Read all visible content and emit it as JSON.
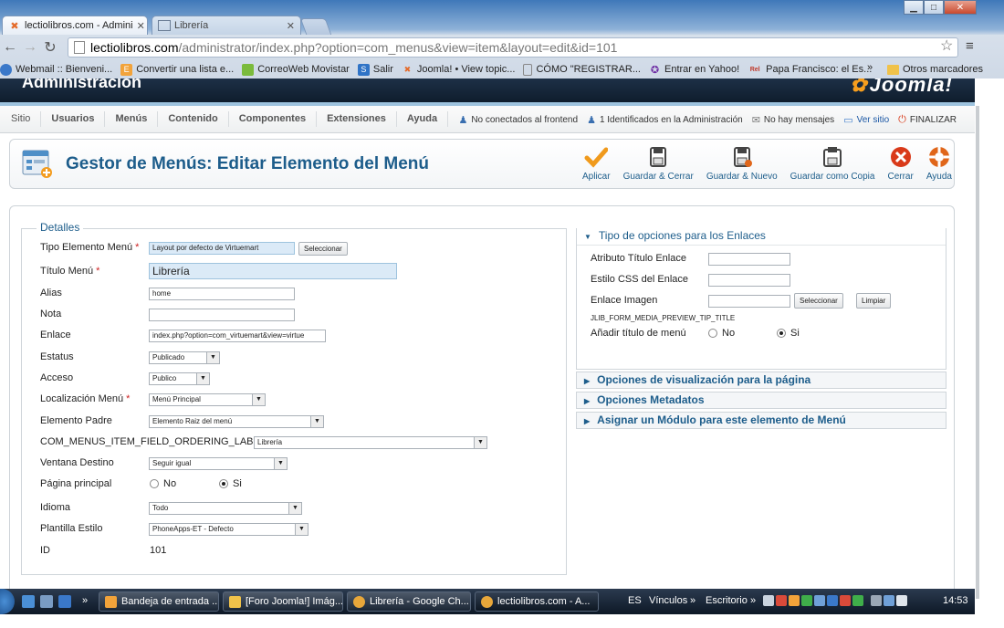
{
  "browser": {
    "tabs": [
      {
        "label": "lectiolibros.com - Admini",
        "active": true
      },
      {
        "label": "Librería",
        "active": false
      }
    ],
    "url_host": "lectiolibros.com",
    "url_path": "/administrator/index.php?option=com_menus&view=item&layout=edit&id=101",
    "bookmarks": [
      {
        "label": "Webmail :: Bienveni...",
        "color": "#3a78c9"
      },
      {
        "label": "Convertir una lista e...",
        "color": "#f2a33a"
      },
      {
        "label": "CorreoWeb Movistar",
        "color": "#7bbb3c"
      },
      {
        "label": "Salir",
        "color": "#2f73c6"
      },
      {
        "label": "Joomla! • View topic...",
        "color": "#e46b2b"
      },
      {
        "label": "CÓMO \"REGISTRAR...",
        "color": "#bbbbbb"
      },
      {
        "label": "Entrar en Yahoo!",
        "color": "#6e2da3"
      },
      {
        "label": "Papa Francisco: el Es...",
        "color": "#c0392b"
      }
    ],
    "bookmarks_more": "»",
    "bookmarks_other": "Otros marcadores"
  },
  "joomla": {
    "header_title": "Administración",
    "logo_text": "Joomla!",
    "menu": [
      "Sitio",
      "Usuarios",
      "Menús",
      "Contenido",
      "Componentes",
      "Extensiones",
      "Ayuda"
    ],
    "status": {
      "frontend": "No conectados al frontend",
      "admin": "1 Identificados en la Administración",
      "messages": "No hay mensajes",
      "view_site": "Ver sitio",
      "logout": "FINALIZAR"
    }
  },
  "toolbar": {
    "title": "Gestor de Menús: Editar Elemento del Menú",
    "actions": [
      {
        "label": "Aplicar",
        "icon": "check-icon",
        "color": "#f09a1c"
      },
      {
        "label": "Guardar & Cerrar",
        "icon": "save-close-icon",
        "color": "#444"
      },
      {
        "label": "Guardar & Nuevo",
        "icon": "save-new-icon",
        "color": "#444"
      },
      {
        "label": "Guardar como Copia",
        "icon": "save-copy-icon",
        "color": "#444"
      },
      {
        "label": "Cerrar",
        "icon": "cancel-icon",
        "color": "#d93a1a"
      },
      {
        "label": "Ayuda",
        "icon": "help-icon",
        "color": "#e0661a"
      }
    ]
  },
  "details": {
    "legend": "Detalles",
    "type_label": "Tipo Elemento Menú",
    "type_value": "Layout por defecto de Virtuemart",
    "type_button": "Seleccionar",
    "title_label": "Título Menú",
    "title_value": "Librería",
    "alias_label": "Alias",
    "alias_value": "home",
    "note_label": "Nota",
    "note_value": "",
    "link_label": "Enlace",
    "link_value": "index.php?option=com_virtuemart&view=virtue",
    "status_label": "Estatus",
    "status_value": "Publicado",
    "access_label": "Acceso",
    "access_value": "Publico",
    "location_label": "Localización Menú",
    "location_value": "Menú Principal",
    "parent_label": "Elemento Padre",
    "parent_value": "Elemento Raiz del menú",
    "ordering_label": "COM_MENUS_ITEM_FIELD_ORDERING_LABEL",
    "ordering_value": "Librería",
    "target_label": "Ventana Destino",
    "target_value": "Seguir igual",
    "home_label": "Página principal",
    "home_no": "No",
    "home_yes": "Si",
    "language_label": "Idioma",
    "language_value": "Todo",
    "template_label": "Plantilla Estilo",
    "template_value": "PhoneApps-ET - Defecto",
    "id_label": "ID",
    "id_value": "101"
  },
  "link_options": {
    "heading": "Tipo de opciones para los Enlaces",
    "title_attr_label": "Atributo Título Enlace",
    "title_attr_value": "",
    "css_label": "Estilo CSS del Enlace",
    "css_value": "",
    "image_label": "Enlace Imagen",
    "image_value": "",
    "image_select": "Seleccionar",
    "image_clear": "Limpiar",
    "preview_tip": "JLIB_FORM_MEDIA_PREVIEW_TIP_TITLE",
    "add_title_label": "Añadir título de menú",
    "add_title_no": "No",
    "add_title_yes": "Si"
  },
  "collapsed_panels": [
    "Opciones de visualización para la página",
    "Opciones Metadatos",
    "Asignar un Módulo para este elemento de Menú"
  ],
  "taskbar": {
    "tasks": [
      {
        "label": "Bandeja de entrada ...",
        "color": "#f2a33a"
      },
      {
        "label": "[Foro Joomla!] Imág...",
        "color": "#f0c24a"
      },
      {
        "label": "Librería - Google Ch...",
        "color": "#e8a73a"
      },
      {
        "label": "lectiolibros.com - A...",
        "color": "#e8a73a"
      }
    ],
    "lang": "ES",
    "links": "Vínculos",
    "desktop": "Escritorio",
    "chevron": "»",
    "time": "14:53"
  }
}
